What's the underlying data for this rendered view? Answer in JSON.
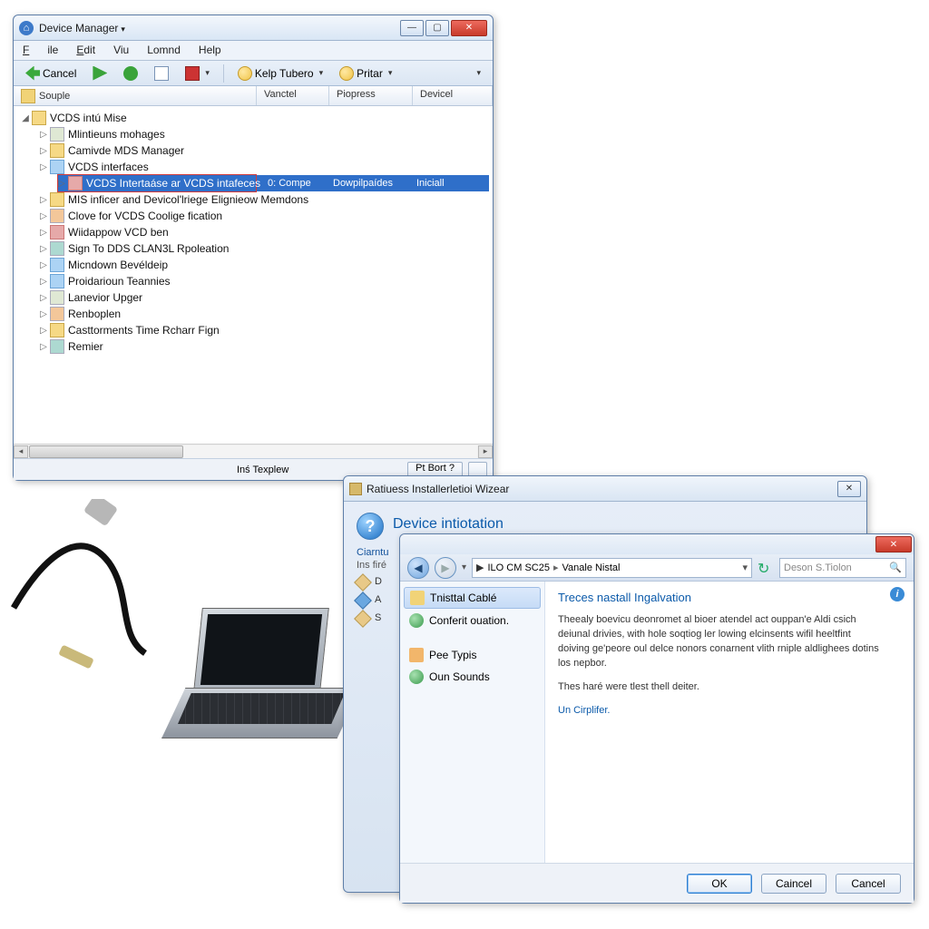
{
  "devmgr": {
    "title": "Device Manager",
    "menu": {
      "file": "File",
      "edit": "Edit",
      "view": "Viu",
      "command": "Lomnd",
      "help": "Help"
    },
    "toolbar": {
      "cancel": "Cancel",
      "help_tubero": "Kelp Tubero",
      "printer": "Pritar"
    },
    "columns": {
      "c1": "Souple",
      "c2": "Vanctel",
      "c3": "Piopress",
      "c4": "Devicel"
    },
    "root": "VCDS intú Mise",
    "nodes": [
      "Mlintieuns mohages",
      "Camivde MDS Manager",
      "VCDS interfaces",
      "VCDS Intertaáse ar VCDS intafeces",
      "MIS inficer and Devicol'lriege Elignieow Memdons",
      "Clove for VCDS Coolige fication",
      "Wiidappow VCD ben",
      "Sign To DDS CLAN3L Rpoleation",
      "Micndown Bevéldeip",
      "Proidarioun Teannies",
      "Lanevior Upger",
      "Renboplen",
      "Casttorments Time Rcharr Fign",
      "Remier"
    ],
    "sel_extra": {
      "c2": "0: Compe",
      "c3": "Dowpilpaídes",
      "c4": "Iniciall"
    },
    "footer": {
      "left": "Inś Texplew"
    }
  },
  "wizard": {
    "title": "Ratiuess Installerletioi Wizear",
    "heading": "Device intiotation",
    "line1": "Ciarntu",
    "line2": "Ins firé",
    "bullets": {
      "b1": "D",
      "b2": "A",
      "b3": "S"
    }
  },
  "explorer": {
    "nav": {
      "crumb1": "ILO CM SC25",
      "crumb2": "Vanale Nistal",
      "refresh_hint": "↻"
    },
    "search_placeholder": "Deson S.Tiolon",
    "side": {
      "s1": "Tnisttal Cablé",
      "s2": "Conferit ouation.",
      "s3": "Pee Typis",
      "s4": "Oun Sounds"
    },
    "main": {
      "heading": "Treces nastall Ingalvation",
      "p1": "Theealy boevicu deonromet al bioer atendel act ouppan'e Aldi csich deiunal drivies, with hole soqtiog ler lowing elcinsents wifil heeltfint doiving ge'peore oul delce nonors conarnent vlith rniple aldlighees dotins los nepbor.",
      "p2": "Thes haré were tlest thell deiter.",
      "link": "Un Cirplifer."
    },
    "buttons": {
      "ok": "OK",
      "cancel1": "Caincel",
      "cancel2": "Cancel"
    }
  }
}
